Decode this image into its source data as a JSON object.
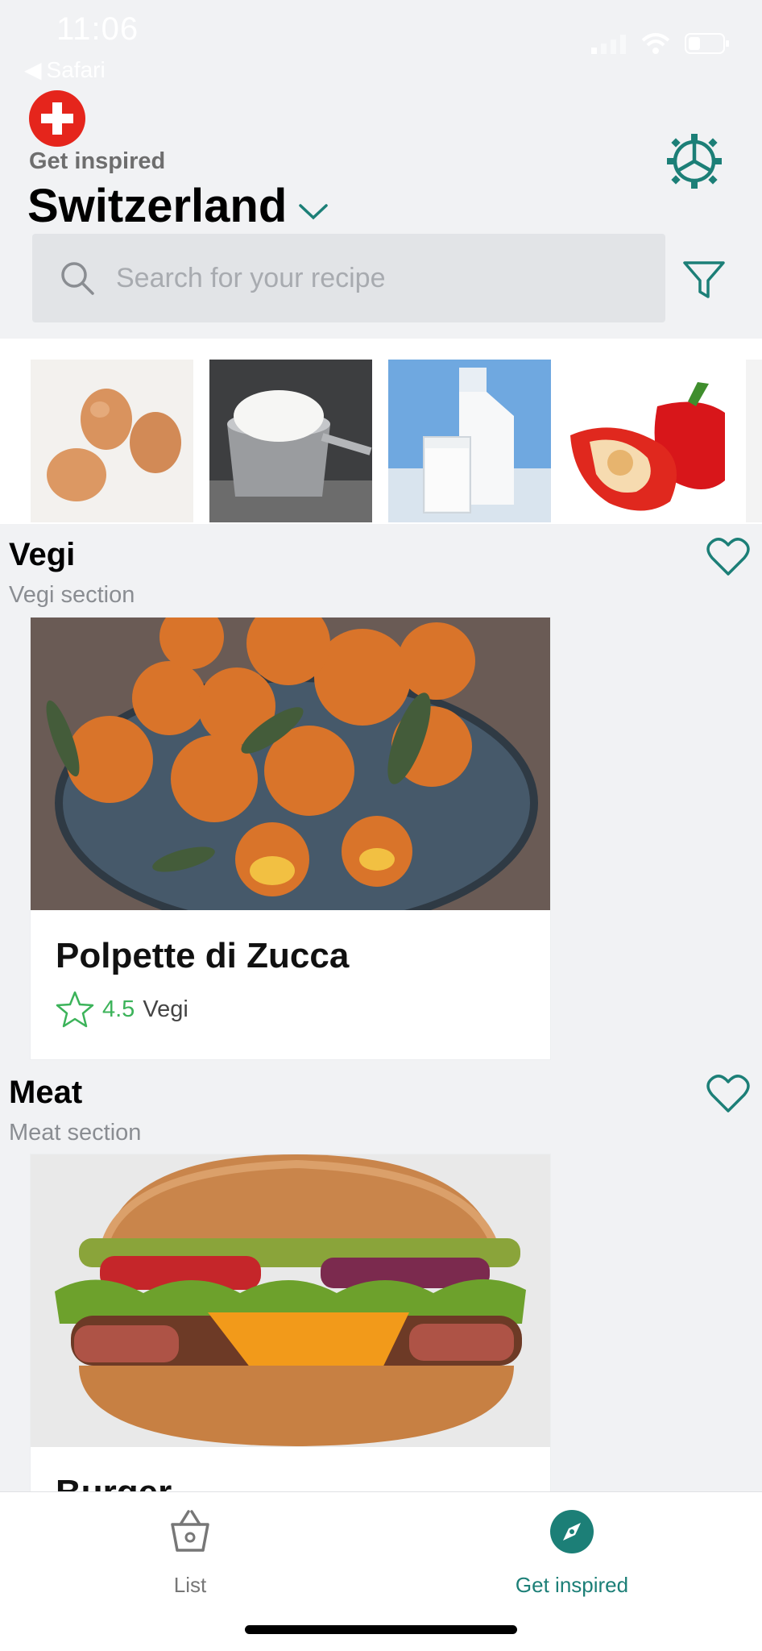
{
  "status": {
    "time": "11:06",
    "back": "Safari"
  },
  "header": {
    "subtitle": "Get inspired",
    "country": "Switzerland"
  },
  "search": {
    "placeholder": "Search for your recipe"
  },
  "ingredients": [
    {
      "name": "eggs"
    },
    {
      "name": "flour"
    },
    {
      "name": "milk"
    },
    {
      "name": "bell-pepper"
    }
  ],
  "sections": [
    {
      "title": "Vegi",
      "subtitle": "Vegi section",
      "recipe": {
        "name": "Polpette di Zucca",
        "rating": "4.5",
        "category": "Vegi"
      }
    },
    {
      "title": "Meat",
      "subtitle": "Meat section",
      "recipe": {
        "name": "Burger"
      }
    }
  ],
  "tabs": [
    {
      "label": "List",
      "icon": "basket-icon",
      "active": false
    },
    {
      "label": "Get inspired",
      "icon": "compass-icon",
      "active": true
    }
  ],
  "colors": {
    "accent": "#1c7f77",
    "rating": "#3cb35a",
    "flag": "#e5251c"
  }
}
